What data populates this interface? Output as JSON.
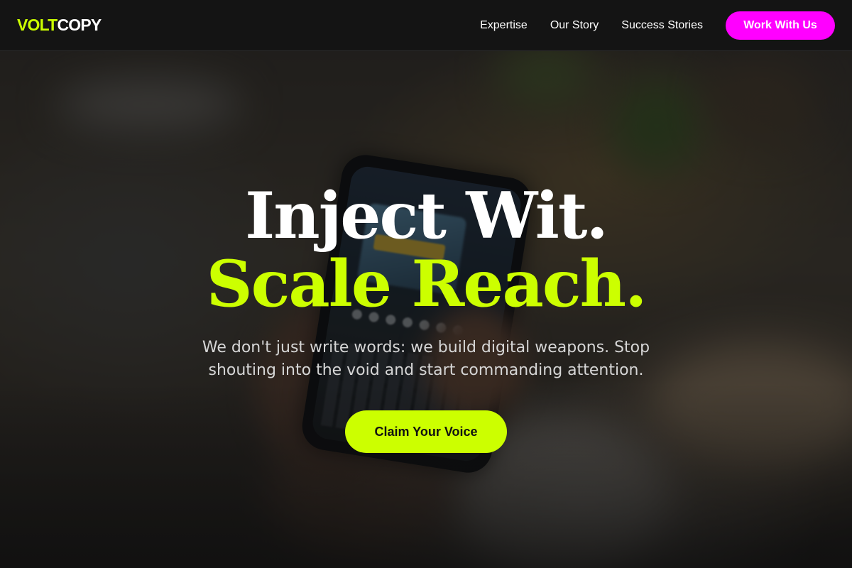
{
  "brand": {
    "logo_part1": "VOLT",
    "logo_part2": "COPY",
    "accent_color": "#ccff00",
    "cta_color": "#ff00ff"
  },
  "nav": {
    "items": [
      {
        "label": "Expertise"
      },
      {
        "label": "Our Story"
      },
      {
        "label": "Success Stories"
      }
    ],
    "cta_label": "Work With Us"
  },
  "hero": {
    "headline_line1": "Inject Wit.",
    "headline_line2": "Scale Reach.",
    "subtitle": "We don't just write words: we build digital weapons. Stop shouting into the void and start commanding attention.",
    "cta_label": "Claim Your Voice",
    "background_image": "blurred photo of hands holding a smartphone"
  }
}
